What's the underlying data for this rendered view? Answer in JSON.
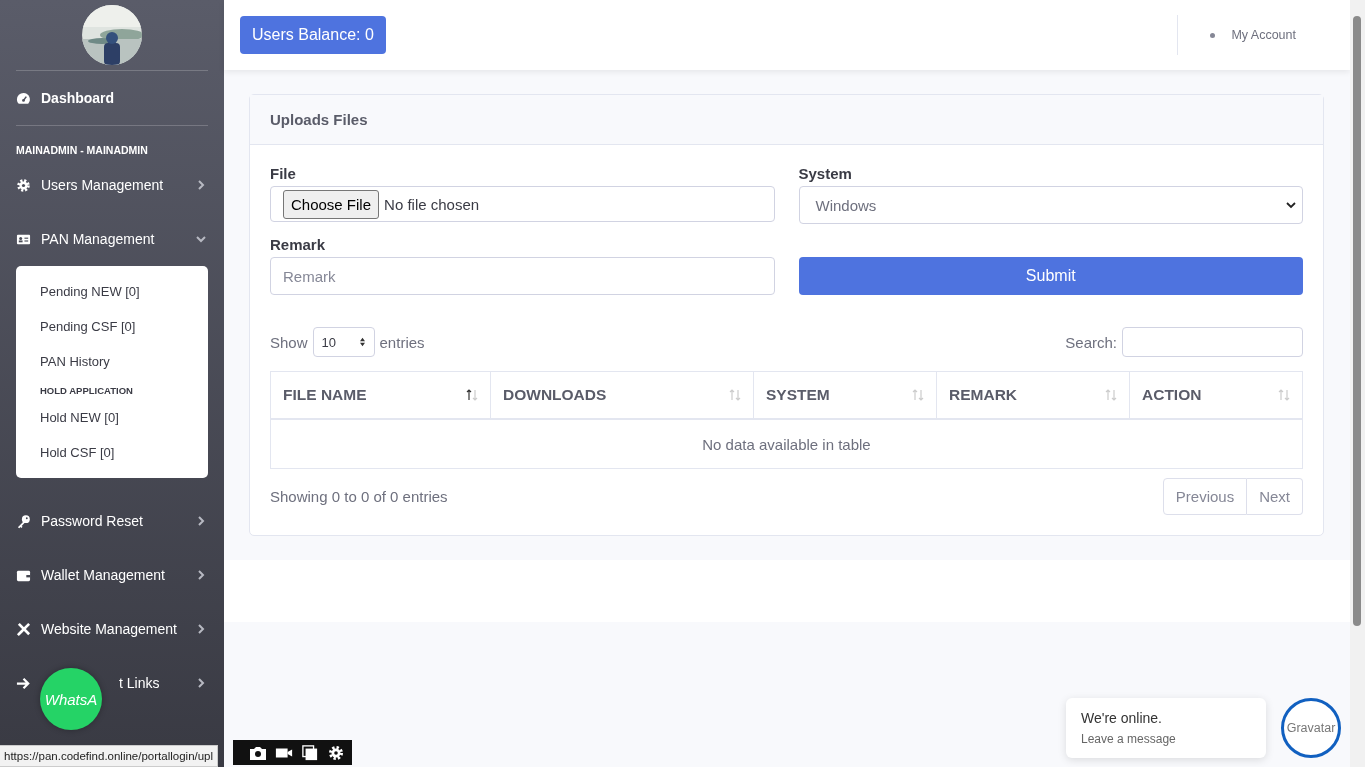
{
  "sidebar": {
    "dashboard": "Dashboard",
    "heading": "MAINADMIN - MAINADMIN",
    "items": [
      {
        "label": "Users Management",
        "expanded": false
      },
      {
        "label": "PAN Management",
        "expanded": true,
        "children": [
          {
            "kind": "link",
            "label": "Pending NEW [0]"
          },
          {
            "kind": "link",
            "label": "Pending CSF [0]"
          },
          {
            "kind": "link",
            "label": "PAN History"
          },
          {
            "kind": "heading",
            "label": "HOLD APPLICATION"
          },
          {
            "kind": "link",
            "label": "Hold NEW [0]"
          },
          {
            "kind": "link",
            "label": "Hold CSF [0]"
          }
        ]
      },
      {
        "label": "Password Reset",
        "expanded": false
      },
      {
        "label": "Wallet Management",
        "expanded": false
      },
      {
        "label": "Website Management",
        "expanded": false
      },
      {
        "label": "t Links",
        "expanded": false
      }
    ]
  },
  "topbar": {
    "balance_button": "Users Balance: 0",
    "account": "My Account"
  },
  "card": {
    "title": "Uploads Files",
    "file_label": "File",
    "file_button": "Choose File",
    "file_status": "No file chosen",
    "system_label": "System",
    "system_value": "Windows",
    "remark_label": "Remark",
    "remark_placeholder": "Remark",
    "submit": "Submit"
  },
  "table": {
    "show": "Show",
    "length": "10",
    "entries": "entries",
    "search_label": "Search:",
    "columns": [
      {
        "label": "FILE NAME",
        "sorted_ascending": true
      },
      {
        "label": "DOWNLOADS",
        "sorted_ascending": false
      },
      {
        "label": "SYSTEM",
        "sorted_ascending": false
      },
      {
        "label": "REMARK",
        "sorted_ascending": false
      },
      {
        "label": "ACTION",
        "sorted_ascending": false
      }
    ],
    "empty": "No data available in table",
    "info": "Showing 0 to 0 of 0 entries",
    "previous": "Previous",
    "next": "Next"
  },
  "whatsapp": "WhatsA",
  "status_url": "https://pan.codefind.online/portallogin/upl",
  "chat": {
    "title": "We're online.",
    "subtitle": "Leave a message",
    "avatar": "Gravatar"
  }
}
